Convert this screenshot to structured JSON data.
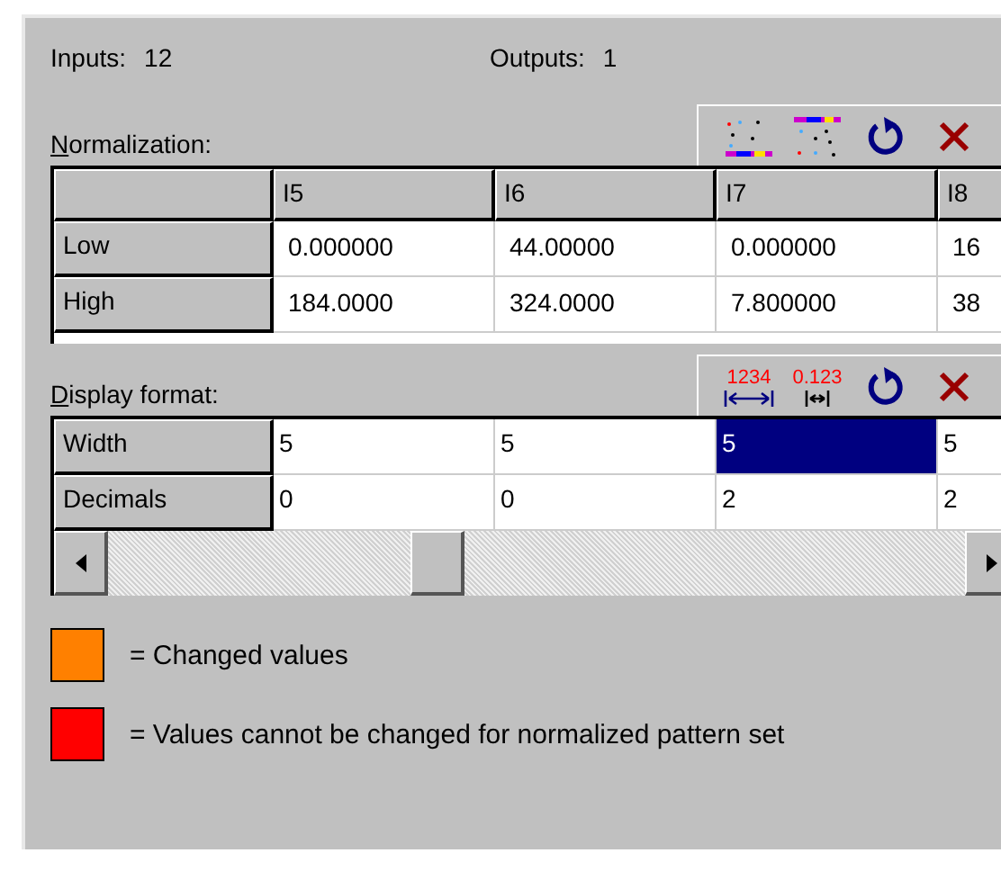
{
  "counts": [
    {
      "label": "Inputs:",
      "value": "12"
    },
    {
      "label": "Outputs:",
      "value": "1"
    }
  ],
  "normalization": {
    "label": "Normalization:",
    "tools": [
      {
        "kind": "scatter"
      },
      {
        "kind": "range"
      },
      {
        "kind": "undo"
      },
      {
        "kind": "delete"
      }
    ],
    "columns": [
      "I5",
      "I6",
      "I7",
      "I8"
    ],
    "rows": [
      {
        "label": "Low",
        "cells": [
          {
            "text": "0.000000",
            "selected": false
          },
          {
            "text": "44.00000",
            "selected": false
          },
          {
            "text": "0.000000",
            "selected": false
          },
          {
            "text": "16",
            "selected": false
          }
        ]
      },
      {
        "label": "High",
        "cells": [
          {
            "text": "184.0000",
            "selected": false
          },
          {
            "text": "324.0000",
            "selected": false
          },
          {
            "text": "7.800000",
            "selected": false
          },
          {
            "text": "38",
            "selected": false
          }
        ]
      }
    ]
  },
  "display_format": {
    "label": "Display format:",
    "tools": [
      {
        "kind": "width",
        "text": "1234"
      },
      {
        "kind": "decimals",
        "text": "0.123"
      },
      {
        "kind": "undo"
      },
      {
        "kind": "delete"
      }
    ],
    "rows": [
      {
        "label": "Width",
        "cells": [
          {
            "text": "5",
            "selected": false
          },
          {
            "text": "5",
            "selected": false
          },
          {
            "text": "5",
            "selected": true
          },
          {
            "text": "5",
            "selected": false
          }
        ]
      },
      {
        "label": "Decimals",
        "cells": [
          {
            "text": "0",
            "selected": false
          },
          {
            "text": "0",
            "selected": false
          },
          {
            "text": "2",
            "selected": false
          },
          {
            "text": "2",
            "selected": false
          }
        ]
      }
    ]
  },
  "legend": [
    {
      "color": "#ff8000",
      "text": "= Changed values"
    },
    {
      "color": "#ff0000",
      "text": "= Values cannot be changed for normalized pattern set"
    }
  ]
}
